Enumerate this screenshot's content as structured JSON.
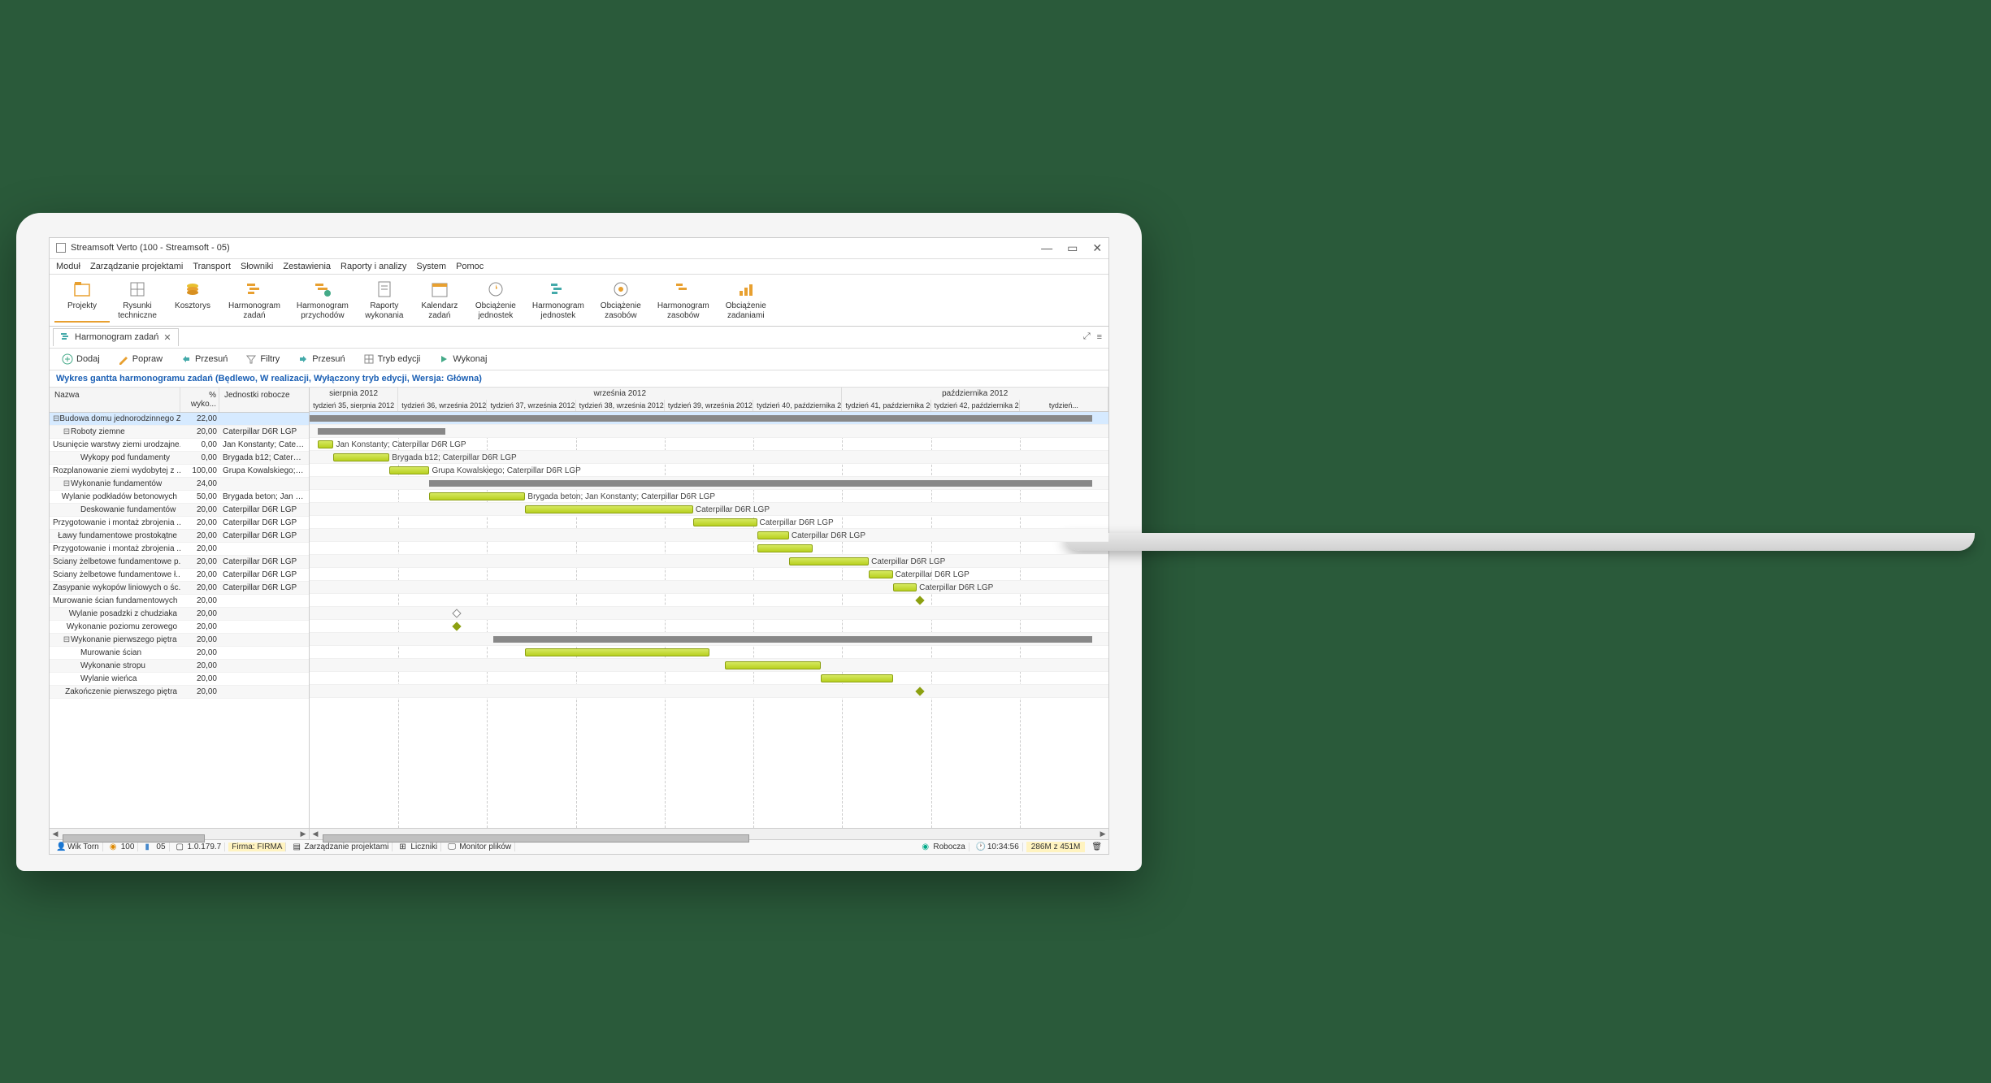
{
  "window": {
    "title": "Streamsoft Verto (100 - Streamsoft - 05)"
  },
  "menu": [
    "Moduł",
    "Zarządzanie projektami",
    "Transport",
    "Słowniki",
    "Zestawienia",
    "Raporty i analizy",
    "System",
    "Pomoc"
  ],
  "ribbon": [
    {
      "label": "Projekty",
      "icon": "projects"
    },
    {
      "label": "Rysunki techniczne",
      "icon": "drawings"
    },
    {
      "label": "Kosztorys",
      "icon": "coins"
    },
    {
      "label": "Harmonogram zadań",
      "icon": "gantt"
    },
    {
      "label": "Harmonogram przychodów",
      "icon": "gantt2"
    },
    {
      "label": "Raporty wykonania",
      "icon": "report"
    },
    {
      "label": "Kalendarz zadań",
      "icon": "calendar"
    },
    {
      "label": "Obciążenie jednostek",
      "icon": "load"
    },
    {
      "label": "Harmonogram jednostek",
      "icon": "sched"
    },
    {
      "label": "Obciążenie zasobów",
      "icon": "load2"
    },
    {
      "label": "Harmonogram zasobów",
      "icon": "sched2"
    },
    {
      "label": "Obciążenie zadaniami",
      "icon": "load3"
    }
  ],
  "tab": {
    "label": "Harmonogram zadań"
  },
  "toolbar": [
    {
      "label": "Dodaj",
      "icon": "plus"
    },
    {
      "label": "Popraw",
      "icon": "pencil"
    },
    {
      "label": "Przesuń",
      "icon": "move"
    },
    {
      "label": "Filtry",
      "icon": "funnel"
    },
    {
      "label": "Przesuń",
      "icon": "move2"
    },
    {
      "label": "Tryb edycji",
      "icon": "grid"
    },
    {
      "label": "Wykonaj",
      "icon": "play"
    }
  ],
  "chart_title": "Wykres gantta harmonogramu zadań (Będlewo, W realizacji, Wyłączony tryb edycji, Wersja: Główna)",
  "columns": {
    "name": "Nazwa",
    "pct": "% wyko...",
    "unit": "Jednostki robocze"
  },
  "timeline": {
    "months": [
      {
        "label": "sierpnia 2012",
        "span": 1
      },
      {
        "label": "września 2012",
        "span": 5
      },
      {
        "label": "października 2012",
        "span": 3
      }
    ],
    "weeks": [
      "tydzień 35, sierpnia 2012",
      "tydzień 36, września 2012",
      "tydzień 37, września 2012",
      "tydzień 38, września 2012",
      "tydzień 39, września 2012",
      "tydzień 40, października 20...",
      "tydzień 41, października 20...",
      "tydzień 42, października 20...",
      "tydzień..."
    ]
  },
  "tasks": [
    {
      "name": "Budowa domu jednorodzinnego Z...",
      "pct": "22,00",
      "unit": "",
      "indent": 0,
      "collapse": true,
      "highlight": true,
      "type": "summary",
      "start": 0,
      "end": 100
    },
    {
      "name": "Roboty ziemne",
      "pct": "20,00",
      "unit": "Caterpillar D6R LGP",
      "indent": 1,
      "collapse": true,
      "type": "summary",
      "start": 1,
      "end": 17
    },
    {
      "name": "Usunięcie warstwy ziemi urodzajne...",
      "pct": "0,00",
      "unit": "Jan Konstanty; Caterpill...",
      "indent": 2,
      "type": "task",
      "start": 1,
      "end": 3,
      "label": "Jan Konstanty; Caterpillar D6R LGP"
    },
    {
      "name": "Wykopy pod fundamenty",
      "pct": "0,00",
      "unit": "Brygada b12; Caterpillar...",
      "indent": 2,
      "type": "task",
      "start": 3,
      "end": 10,
      "label": "Brygada b12; Caterpillar D6R LGP"
    },
    {
      "name": "Rozplanowanie ziemi wydobytej z ...",
      "pct": "100,00",
      "unit": "Grupa Kowalskiego; Cat...",
      "indent": 2,
      "type": "task",
      "start": 10,
      "end": 15,
      "label": "Grupa Kowalskiego; Caterpillar D6R LGP"
    },
    {
      "name": "Wykonanie fundamentów",
      "pct": "24,00",
      "unit": "",
      "indent": 1,
      "collapse": true,
      "type": "summary",
      "start": 15,
      "end": 100
    },
    {
      "name": "Wylanie podkładów betonowych",
      "pct": "50,00",
      "unit": "Brygada beton; Jan Kon...",
      "indent": 2,
      "type": "task",
      "start": 15,
      "end": 27,
      "label": "Brygada beton; Jan Konstanty; Caterpillar D6R LGP"
    },
    {
      "name": "Deskowanie fundamentów",
      "pct": "20,00",
      "unit": "Caterpillar D6R LGP",
      "indent": 2,
      "type": "task",
      "start": 27,
      "end": 48,
      "label": "Caterpillar D6R LGP"
    },
    {
      "name": "Przygotowanie i montaż zbrojenia ...",
      "pct": "20,00",
      "unit": "Caterpillar D6R LGP",
      "indent": 2,
      "type": "task",
      "start": 48,
      "end": 56,
      "label": "Caterpillar D6R LGP"
    },
    {
      "name": "Ławy fundamentowe prostokątne",
      "pct": "20,00",
      "unit": "Caterpillar D6R LGP",
      "indent": 2,
      "type": "task",
      "start": 56,
      "end": 60,
      "label": "Caterpillar D6R LGP"
    },
    {
      "name": "Przygotowanie i montaż zbrojenia ...",
      "pct": "20,00",
      "unit": "",
      "indent": 2,
      "type": "task",
      "start": 56,
      "end": 63
    },
    {
      "name": "Ściany żelbetowe fundamentowe p...",
      "pct": "20,00",
      "unit": "Caterpillar D6R LGP",
      "indent": 2,
      "type": "task",
      "start": 60,
      "end": 70,
      "label": "Caterpillar D6R LGP"
    },
    {
      "name": "Ściany żelbetowe fundamentowe ł...",
      "pct": "20,00",
      "unit": "Caterpillar D6R LGP",
      "indent": 2,
      "type": "task",
      "start": 70,
      "end": 73,
      "label": "Caterpillar D6R LGP"
    },
    {
      "name": "Zasypanie wykopów liniowych o śc...",
      "pct": "20,00",
      "unit": "Caterpillar D6R LGP",
      "indent": 2,
      "type": "task",
      "start": 73,
      "end": 76,
      "label": "Caterpillar D6R LGP"
    },
    {
      "name": "Murowanie ścian fundamentowych",
      "pct": "20,00",
      "unit": "",
      "indent": 2,
      "type": "milestone",
      "start": 76
    },
    {
      "name": "Wylanie posadzki z chudziaka",
      "pct": "20,00",
      "unit": "",
      "indent": 2,
      "type": "milestone-open",
      "start": 18
    },
    {
      "name": "Wykonanie poziomu zerowego",
      "pct": "20,00",
      "unit": "",
      "indent": 2,
      "type": "milestone",
      "start": 18
    },
    {
      "name": "Wykonanie pierwszego piętra",
      "pct": "20,00",
      "unit": "",
      "indent": 1,
      "collapse": true,
      "type": "summary",
      "start": 23,
      "end": 100
    },
    {
      "name": "Murowanie ścian",
      "pct": "20,00",
      "unit": "",
      "indent": 2,
      "type": "task",
      "start": 27,
      "end": 50
    },
    {
      "name": "Wykonanie stropu",
      "pct": "20,00",
      "unit": "",
      "indent": 2,
      "type": "task",
      "start": 52,
      "end": 64
    },
    {
      "name": "Wylanie wieńca",
      "pct": "20,00",
      "unit": "",
      "indent": 2,
      "type": "task",
      "start": 64,
      "end": 73
    },
    {
      "name": "Zakończenie pierwszego piętra",
      "pct": "20,00",
      "unit": "",
      "indent": 2,
      "type": "milestone",
      "start": 76
    }
  ],
  "statusbar": {
    "user": "Wik Torn",
    "n1": "100",
    "n2": "05",
    "version": "1.0.179.7",
    "firma": "Firma: FIRMA",
    "module": "Zarządzanie projektami",
    "counters": "Liczniki",
    "monitor": "Monitor plików",
    "mode": "Robocza",
    "time": "10:34:56",
    "memory": "286M z 451M"
  }
}
